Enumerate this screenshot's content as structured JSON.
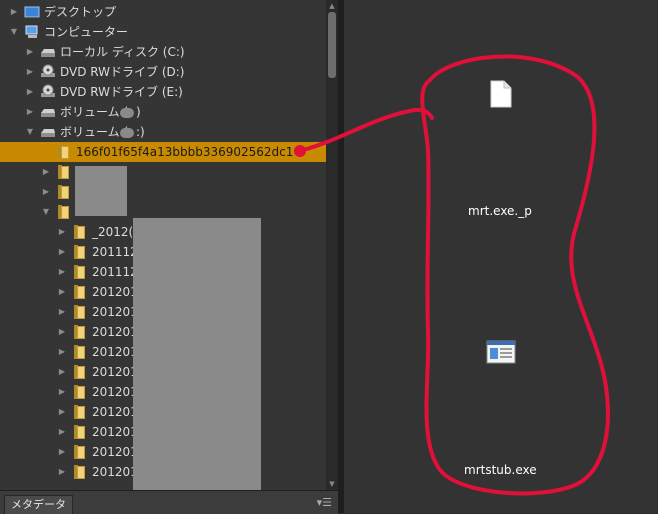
{
  "tree": {
    "items": [
      {
        "label": "デスクトップ",
        "indent": 0,
        "expand": "collapsed",
        "icon": "desktop-icon"
      },
      {
        "label": "コンピューター",
        "indent": 0,
        "expand": "expanded",
        "icon": "computer-icon"
      },
      {
        "label": "ローカル ディスク (C:)",
        "indent": 1,
        "expand": "collapsed",
        "icon": "drive-icon"
      },
      {
        "label": "DVD RWドライブ (D:)",
        "indent": 1,
        "expand": "collapsed",
        "icon": "dvd-icon"
      },
      {
        "label": "DVD RWドライブ (E:)",
        "indent": 1,
        "expand": "collapsed",
        "icon": "dvd-icon"
      },
      {
        "label": "ボリューム (",
        "indent": 1,
        "expand": "collapsed",
        "icon": "drive-icon",
        "suffix": ")",
        "redacted": true
      },
      {
        "label": "ボリューム (",
        "indent": 1,
        "expand": "expanded",
        "icon": "drive-icon",
        "suffix": ":)",
        "redacted": true
      },
      {
        "label": "166f01f65f4a13bbbb336902562dc1",
        "indent": 2,
        "expand": "none",
        "icon": "folder-icon",
        "selected": true
      },
      {
        "label": "",
        "indent": 2,
        "expand": "collapsed",
        "icon": "folder-icon"
      },
      {
        "label": "",
        "indent": 2,
        "expand": "collapsed",
        "icon": "folder-icon"
      },
      {
        "label": "",
        "indent": 2,
        "expand": "expanded",
        "icon": "folder-icon"
      },
      {
        "label": "_2012(",
        "indent": 3,
        "expand": "collapsed",
        "icon": "folder-icon"
      },
      {
        "label": "201112",
        "indent": 3,
        "expand": "collapsed",
        "icon": "folder-icon"
      },
      {
        "label": "201112",
        "indent": 3,
        "expand": "collapsed",
        "icon": "folder-icon"
      },
      {
        "label": "201201",
        "indent": 3,
        "expand": "collapsed",
        "icon": "folder-icon"
      },
      {
        "label": "201201",
        "indent": 3,
        "expand": "collapsed",
        "icon": "folder-icon"
      },
      {
        "label": "201201",
        "indent": 3,
        "expand": "collapsed",
        "icon": "folder-icon"
      },
      {
        "label": "201201",
        "indent": 3,
        "expand": "collapsed",
        "icon": "folder-icon"
      },
      {
        "label": "201201",
        "indent": 3,
        "expand": "collapsed",
        "icon": "folder-icon"
      },
      {
        "label": "201201",
        "indent": 3,
        "expand": "collapsed",
        "icon": "folder-icon"
      },
      {
        "label": "201201",
        "indent": 3,
        "expand": "collapsed",
        "icon": "folder-icon"
      },
      {
        "label": "201201",
        "indent": 3,
        "expand": "collapsed",
        "icon": "folder-icon"
      },
      {
        "label": "201201",
        "indent": 3,
        "expand": "collapsed",
        "icon": "folder-icon"
      },
      {
        "label": "201201",
        "indent": 3,
        "expand": "collapsed",
        "icon": "folder-icon"
      }
    ]
  },
  "panel": {
    "metadata_tab": "メタデータ",
    "menu_icon": "panel-menu-icon"
  },
  "files": [
    {
      "name": "mrt.exe._p",
      "icon": "document-icon"
    },
    {
      "name": "mrtstub.exe",
      "icon": "executable-icon"
    }
  ],
  "colors": {
    "selection": "#c88a00",
    "annotation": "#e0103a",
    "panel_bg": "#353535",
    "content_bg": "#333333"
  }
}
